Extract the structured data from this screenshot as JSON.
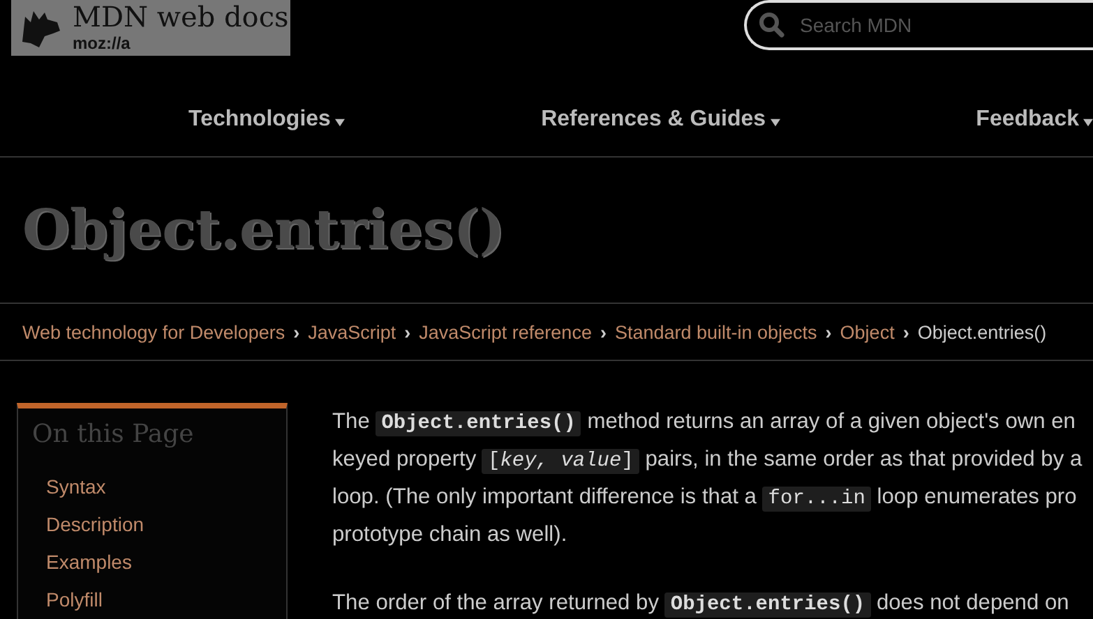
{
  "logo": {
    "title": "MDN web docs",
    "subtitle": "moz://a"
  },
  "search": {
    "placeholder": "Search MDN"
  },
  "nav": [
    {
      "label": "Technologies",
      "expanded": false
    },
    {
      "label": "References & Guides",
      "expanded": false
    },
    {
      "label": "Feedback",
      "expanded": false
    }
  ],
  "page_title": "Object.entries()",
  "breadcrumbs": [
    {
      "label": "Web technology for Developers",
      "kind": "link"
    },
    {
      "label": "›",
      "kind": "separator"
    },
    {
      "label": "JavaScript",
      "kind": "link"
    },
    {
      "label": "›",
      "kind": "separator"
    },
    {
      "label": "JavaScript reference",
      "kind": "link"
    },
    {
      "label": "›",
      "kind": "separator"
    },
    {
      "label": "Standard built-in objects",
      "kind": "link"
    },
    {
      "label": "›",
      "kind": "separator"
    },
    {
      "label": "Object",
      "kind": "link"
    },
    {
      "label": "›",
      "kind": "separator"
    },
    {
      "label": "Object.entries()",
      "kind": "current"
    }
  ],
  "toc": {
    "heading": "On this Page",
    "items": [
      "Syntax",
      "Description",
      "Examples",
      "Polyfill"
    ]
  },
  "paragraphs": [
    [
      [
        {
          "kind": "text",
          "text": "The "
        },
        {
          "kind": "code",
          "text": "**Object.entries()**"
        },
        {
          "kind": "text",
          "text": " method returns an array of a given object's own en"
        }
      ],
      [
        {
          "kind": "text",
          "text": "keyed property "
        },
        {
          "kind": "code",
          "text": "[*key, value*]"
        },
        {
          "kind": "text",
          "text": " pairs, in the same order as that provided by a"
        }
      ],
      [
        {
          "kind": "text",
          "text": "loop. (The only important difference is that a "
        },
        {
          "kind": "code",
          "text": "for...in"
        },
        {
          "kind": "text",
          "text": " loop enumerates pro"
        }
      ],
      [
        {
          "kind": "text",
          "text": "prototype chain as well)."
        }
      ]
    ],
    [
      [
        {
          "kind": "text",
          "text": "The order of the array returned by "
        },
        {
          "kind": "code",
          "text": "**Object.entries()**"
        },
        {
          "kind": "text",
          "text": " does not depend on"
        }
      ]
    ]
  ]
}
